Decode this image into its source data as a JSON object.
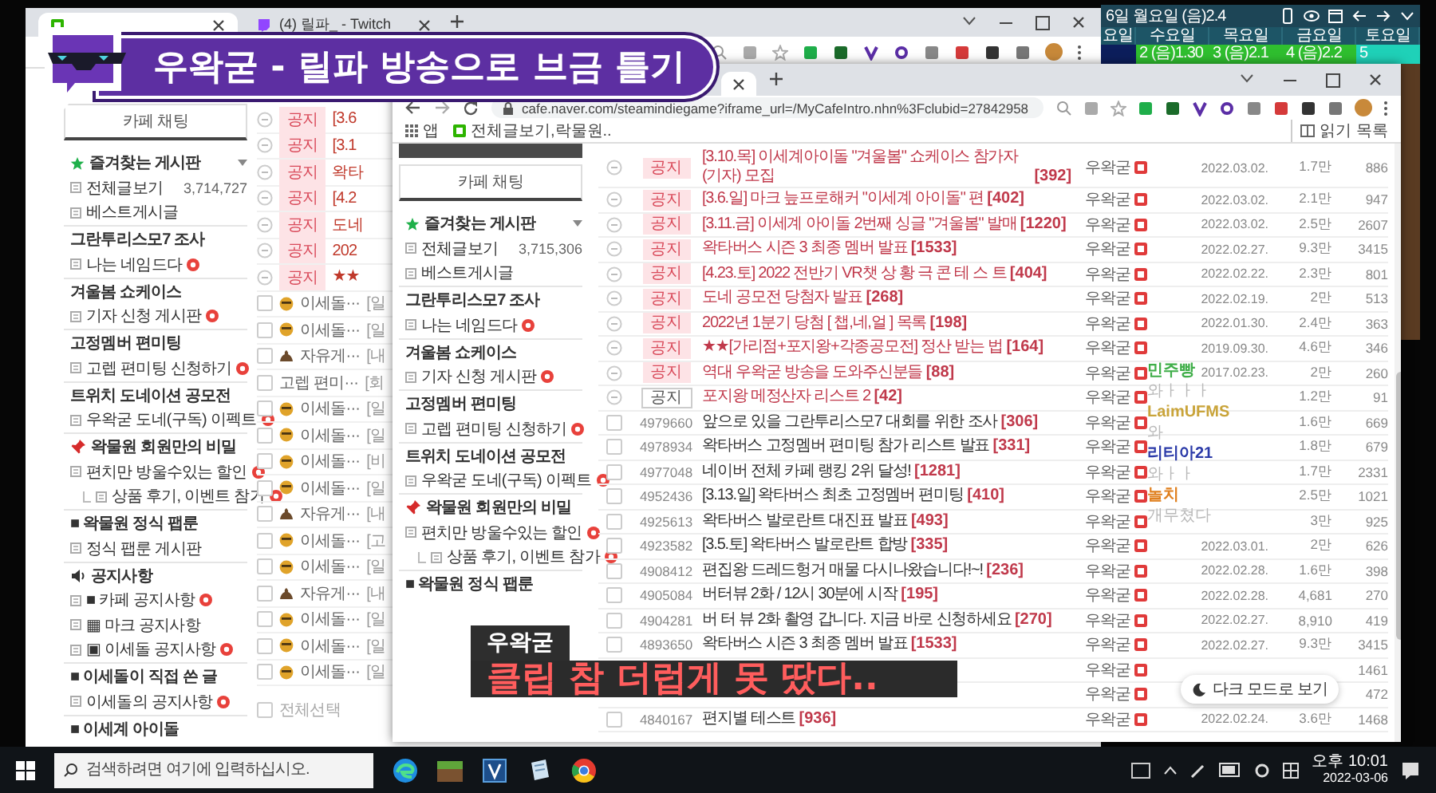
{
  "overlay_title": {
    "text": "우왁굳 - 릴파 방송으로 브금 틀기"
  },
  "caption": {
    "speaker": "우왁굳",
    "text": "클립 참 더럽게 못 땄다.."
  },
  "chat": [
    {
      "user": "민주빵",
      "color": "#3fae49",
      "message": "와ㅏㅏㅏ"
    },
    {
      "user": "LaimUFMS",
      "color": "#c9a43a",
      "message": "와"
    },
    {
      "user": "리티아21",
      "color": "#2b3aa8",
      "message": "와ㅏㅏ"
    },
    {
      "user": "놀치",
      "color": "#e0801f",
      "message": "개무쳤다"
    }
  ],
  "calendar": {
    "title": "6일 월요일 (음)2.4",
    "weekdays": [
      "요일",
      "수요일",
      "목요일",
      "금요일",
      "토요일"
    ],
    "days": [
      {
        "kind": "past"
      },
      {
        "kind": "weekday",
        "label": "2 (음)1.30"
      },
      {
        "kind": "weekday",
        "label": "3 (음)2.1"
      },
      {
        "kind": "weekday",
        "label": "4 (음)2.2"
      },
      {
        "kind": "weekend",
        "label": "5"
      }
    ]
  },
  "back_window": {
    "tabs": [
      {
        "selected": true
      },
      {
        "label": "(4) 릴파_ - Twitch",
        "selected": false
      }
    ],
    "sidebar": {
      "chat_button": "카페 채팅",
      "sections": [
        {
          "kind": "favorites",
          "heading": "즐겨찾는 게시판",
          "items": [
            {
              "label": "전체글보기",
              "count": "3,714,727",
              "new": false
            },
            {
              "label": "베스트게시글",
              "new": false
            }
          ]
        },
        {
          "kind": "plain",
          "heading": "그란투리스모7 조사",
          "items": [
            {
              "label": "나는 네임드다",
              "new": true
            }
          ]
        },
        {
          "kind": "plain",
          "heading": "겨울봄 쇼케이스",
          "items": [
            {
              "label": "기자 신청 게시판",
              "new": true
            }
          ]
        },
        {
          "kind": "plain",
          "heading": "고정멤버 편미팅",
          "items": [
            {
              "label": "고렙 편미팅 신청하기",
              "new": true
            }
          ]
        },
        {
          "kind": "plain",
          "heading": "트위치 도네이션 공모전",
          "items": [
            {
              "label": "우왁굳 도네(구독) 이펙트",
              "new": true
            }
          ]
        },
        {
          "kind": "pin",
          "heading": "왁물원 회원만의 비밀",
          "items": [
            {
              "label": "편치만 방울수있는 할인",
              "new": true,
              "children": [
                {
                  "label": "상품 후기, 이벤트 참가",
                  "new": true
                }
              ]
            }
          ]
        },
        {
          "kind": "plain",
          "heading": "■ 왁물원 정식 팹룬",
          "items": [
            {
              "label": "정식 팹룬 게시판",
              "new": false
            }
          ]
        },
        {
          "kind": "speaker",
          "heading": "공지사항",
          "items": [
            {
              "label": "■ 카페 공지사항",
              "new": true
            },
            {
              "label": "▦ 마크 공지사항",
              "new": false
            },
            {
              "label": "▣ 이세돌 공지사항",
              "new": true
            }
          ]
        },
        {
          "kind": "plain",
          "heading": "■ 이세돌이 직접 쓴 글",
          "items": [
            {
              "label": "이세돌의 공지사항",
              "new": true
            }
          ]
        },
        {
          "kind": "plain",
          "heading": "■ 이세계 아이돌"
        }
      ]
    },
    "posts": [
      {
        "kind": "notice",
        "badge": "공지",
        "title": "[3.6"
      },
      {
        "kind": "notice",
        "badge": "공지",
        "title": "[3.1"
      },
      {
        "kind": "notice",
        "badge": "공지",
        "title": "왁타"
      },
      {
        "kind": "notice",
        "badge": "공지",
        "title": "[4.2"
      },
      {
        "kind": "notice",
        "badge": "공지",
        "title": "도네"
      },
      {
        "kind": "notice",
        "badge": "공지",
        "title": "202"
      },
      {
        "kind": "notice",
        "badge": "공지",
        "title": "★★"
      },
      {
        "kind": "post_face",
        "checked": false,
        "board": "이세돌···",
        "title": "[일"
      },
      {
        "kind": "post_face",
        "checked": false,
        "board": "이세돌···",
        "title": "[일"
      },
      {
        "kind": "post_pile",
        "checked": false,
        "board": "자유게···",
        "title": "[내"
      },
      {
        "kind": "post",
        "checked": false,
        "board": "고렙 편미···",
        "title": "[회"
      },
      {
        "kind": "post_face",
        "checked": false,
        "board": "이세돌···",
        "title": "[일"
      },
      {
        "kind": "post_face",
        "checked": false,
        "board": "이세돌···",
        "title": "[일"
      },
      {
        "kind": "post_face",
        "checked": false,
        "board": "이세돌···",
        "title": "[비"
      },
      {
        "kind": "post_face",
        "checked": false,
        "board": "이세돌···",
        "title": "[일"
      },
      {
        "kind": "post_pile",
        "checked": false,
        "board": "자유게···",
        "title": "[내"
      },
      {
        "kind": "post_face",
        "checked": false,
        "board": "이세돌···",
        "title": "[고"
      },
      {
        "kind": "post_face",
        "checked": false,
        "board": "이세돌···",
        "title": "[일"
      },
      {
        "kind": "post_pile",
        "checked": false,
        "board": "자유게···",
        "title": "[내"
      },
      {
        "kind": "post_face",
        "checked": false,
        "board": "이세돌···",
        "title": "[일"
      },
      {
        "kind": "post_face",
        "checked": false,
        "board": "이세돌···",
        "title": "[일"
      },
      {
        "kind": "post_face",
        "checked": false,
        "board": "이세돌···",
        "title": "[일"
      }
    ],
    "select_all": {
      "label": "전체선택",
      "checked": false
    }
  },
  "front_window": {
    "url": "cafe.naver.com/steamindiegame?iframe_url=/MyCafeIntro.nhn%3Fclubid=27842958",
    "bookmarks": [
      {
        "kind": "apps",
        "label": "앱"
      },
      {
        "kind": "cafe",
        "label": "전체글보기,락물원.."
      }
    ],
    "reading_list": "읽기 목록",
    "sidebar": {
      "chat_button": "카페 채팅",
      "sections": [
        {
          "kind": "favorites",
          "heading": "즐겨찾는 게시판",
          "items": [
            {
              "label": "전체글보기",
              "count": "3,715,306",
              "new": false
            },
            {
              "label": "베스트게시글",
              "new": false
            }
          ]
        },
        {
          "kind": "plain",
          "heading": "그란투리스모7 조사",
          "items": [
            {
              "label": "나는 네임드다",
              "new": true
            }
          ]
        },
        {
          "kind": "plain",
          "heading": "겨울봄 쇼케이스",
          "items": [
            {
              "label": "기자 신청 게시판",
              "new": true
            }
          ]
        },
        {
          "kind": "plain",
          "heading": "고정멤버 편미팅",
          "items": [
            {
              "label": "고렙 편미팅 신청하기",
              "new": true
            }
          ]
        },
        {
          "kind": "plain",
          "heading": "트위치 도네이션 공모전",
          "items": [
            {
              "label": "우왁굳 도네(구독) 이펙트",
              "new": true
            }
          ]
        },
        {
          "kind": "pin",
          "heading": "왁물원 회원만의 비밀",
          "items": [
            {
              "label": "편치만 방울수있는 할인",
              "new": true,
              "children": [
                {
                  "label": "상품 후기, 이벤트 참가",
                  "new": true
                }
              ]
            }
          ]
        },
        {
          "kind": "plain",
          "heading": "■ 왁물원 정식 팹룬"
        }
      ]
    },
    "posts": [
      {
        "kind": "notice",
        "badge": "공지",
        "title": "[3.10.목] 이세계아이돌 \"겨울봄\" 쇼케이스 참가자(기자) 모집",
        "comments": "[392]",
        "author": "우왁굳",
        "date": "2022.03.02.",
        "views": "1.7만",
        "likes": "886"
      },
      {
        "kind": "notice",
        "badge": "공지",
        "title": "[3.6.일] 마크 늪프로해커 \"이세계 아이돌\" 편",
        "comments": "[402]",
        "author": "우왁굳",
        "date": "2022.03.02.",
        "views": "2.1만",
        "likes": "947"
      },
      {
        "kind": "notice",
        "badge": "공지",
        "title": "[3.11.금] 이세계 아이돌 2번째 싱글 \"겨울봄\" 발매",
        "comments": "[1220]",
        "author": "우왁굳",
        "date": "2022.03.02.",
        "views": "2.5만",
        "likes": "2607"
      },
      {
        "kind": "notice",
        "badge": "공지",
        "title": "왁타버스 시즌 3 최종 멤버 발표",
        "comments": "[1533]",
        "author": "우왁굳",
        "date": "2022.02.27.",
        "views": "9.3만",
        "likes": "3415"
      },
      {
        "kind": "notice",
        "badge": "공지",
        "title": "[4.23.토] 2022 전반기 VR챗 상 황 극 콘 테 스 트",
        "comments": "[404]",
        "author": "우왁굳",
        "date": "2022.02.22.",
        "views": "2.3만",
        "likes": "801"
      },
      {
        "kind": "notice",
        "badge": "공지",
        "title": "도네 공모전 당첨자 발표",
        "comments": "[268]",
        "author": "우왁굳",
        "date": "2022.02.19.",
        "views": "2만",
        "likes": "513"
      },
      {
        "kind": "notice",
        "badge": "공지",
        "title": "2022년 1분기 당첨 [ 챕,네,얼 ] 목록",
        "comments": "[198]",
        "author": "우왁굳",
        "date": "2022.01.30.",
        "views": "2.4만",
        "likes": "363"
      },
      {
        "kind": "notice",
        "badge": "공지",
        "title": "★★[가리점+포지왕+각종공모전] 정산 받는 법",
        "comments": "[164]",
        "author": "우왁굳",
        "date": "2019.09.30.",
        "views": "4.6만",
        "likes": "346"
      },
      {
        "kind": "notice",
        "badge": "공지",
        "title": "역대 우왁굳 방송을 도와주신분들",
        "comments": "[88]",
        "author": "우왁굳",
        "date": "2017.02.23.",
        "views": "2만",
        "likes": "260"
      },
      {
        "kind": "notice_plain",
        "badge": "공지",
        "title": "포지왕 메정산자 리스트 2",
        "comments": "[42]",
        "author": "우왁굳",
        "views": "1.2만",
        "likes": "91"
      },
      {
        "kind": "post",
        "checked": false,
        "number": "4979660",
        "title": "앞으로 있을 그란투리스모7 대회를 위한 조사",
        "comments": "[306]",
        "author": "우왁굳",
        "views": "1.6만",
        "likes": "669"
      },
      {
        "kind": "post",
        "checked": false,
        "number": "4978934",
        "title": "왁타버스 고정멤버 편미팅 참가 리스트 발표",
        "comments": "[331]",
        "author": "우왁굳",
        "views": "1.8만",
        "likes": "679"
      },
      {
        "kind": "post",
        "checked": false,
        "number": "4977048",
        "title": "네이버 전체 카페 랭킹 2위 달성!",
        "comments": "[1281]",
        "author": "우왁굳",
        "views": "1.7만",
        "likes": "2331"
      },
      {
        "kind": "post",
        "checked": false,
        "number": "4952436",
        "title": "[3.13.일] 왁타버스 최초 고정멤버 편미팅",
        "comments": "[410]",
        "author": "우왁굳",
        "views": "2.5만",
        "likes": "1021"
      },
      {
        "kind": "post",
        "checked": false,
        "number": "4925613",
        "title": "왁타버스 발로란트 대진표 발표",
        "comments": "[493]",
        "author": "우왁굳",
        "views": "3만",
        "likes": "925"
      },
      {
        "kind": "post",
        "checked": false,
        "number": "4923582",
        "title": "[3.5.토] 왁타버스 발로란트 합방",
        "comments": "[335]",
        "author": "우왁굳",
        "date": "2022.03.01.",
        "views": "2만",
        "likes": "626"
      },
      {
        "kind": "post",
        "checked": false,
        "number": "4908412",
        "title": "편집왕 드레드헝거 매물 다시나왔습니다!~!",
        "comments": "[236]",
        "author": "우왁굳",
        "date": "2022.02.28.",
        "views": "1.6만",
        "likes": "398"
      },
      {
        "kind": "post",
        "checked": false,
        "number": "4905084",
        "title": "버터뷰 2화 / 12시 30분에 시작",
        "comments": "[195]",
        "author": "우왁굳",
        "date": "2022.02.28.",
        "views": "4,681",
        "likes": "270"
      },
      {
        "kind": "post",
        "checked": false,
        "number": "4904281",
        "title": "버 터 뷰 2화 촬영 갑니다. 지금 바로 신청하세요",
        "comments": "[270]",
        "author": "우왁굳",
        "date": "2022.02.27.",
        "views": "8,910",
        "likes": "419"
      },
      {
        "kind": "post",
        "checked": false,
        "number": "4893650",
        "title": "왁타버스 시즌 3 최종 멤버 발표",
        "comments": "[1533]",
        "author": "우왁굳",
        "date": "2022.02.27.",
        "views": "9.3만",
        "likes": "3415"
      },
      {
        "kind": "post",
        "author": "우왁굳",
        "likes": "1461"
      },
      {
        "kind": "post",
        "author": "우왁굳",
        "likes": "472"
      },
      {
        "kind": "post",
        "checked": false,
        "number": "4840167",
        "title": "편지별 테스트",
        "comments": "[936]",
        "author": "우왁굳",
        "date": "2022.02.24.",
        "views": "3.6만",
        "likes": "1468"
      }
    ],
    "dark_mode_button": "다크 모드로 보기"
  },
  "taskbar": {
    "search_placeholder": "검색하려면 여기에 입력하십시오.",
    "time": "오후 10:01",
    "date": "2022-03-06"
  }
}
